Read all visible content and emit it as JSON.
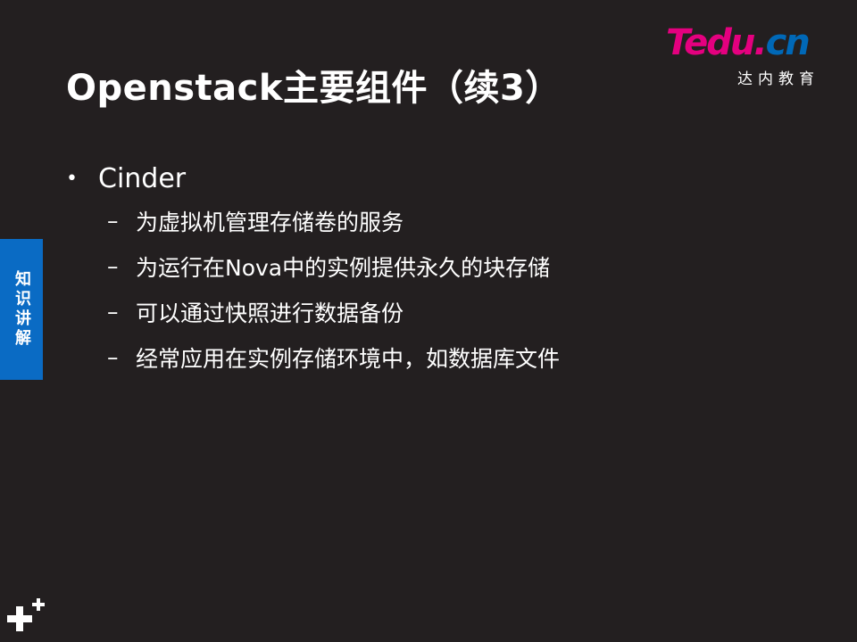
{
  "slide": {
    "title": "Openstack主要组件（续3）",
    "logo": {
      "t": "T",
      "edu": "edu.",
      "cn": "cn",
      "sub": "达内教育"
    },
    "side_tab": "知识讲解",
    "bullets": [
      {
        "label": "Cinder",
        "sub_items": [
          "为虚拟机管理存储卷的服务",
          "为运行在Nova中的实例提供永久的块存储",
          "可以通过快照进行数据备份",
          "经常应用在实例存储环境中，如数据库文件"
        ]
      }
    ],
    "bullet_symbol": "•",
    "dash_symbol": "–"
  },
  "colors": {
    "background": "#231f20",
    "logo_pink": "#e4007f",
    "logo_blue": "#0068b7",
    "tab_blue": "#0a6bc4"
  }
}
